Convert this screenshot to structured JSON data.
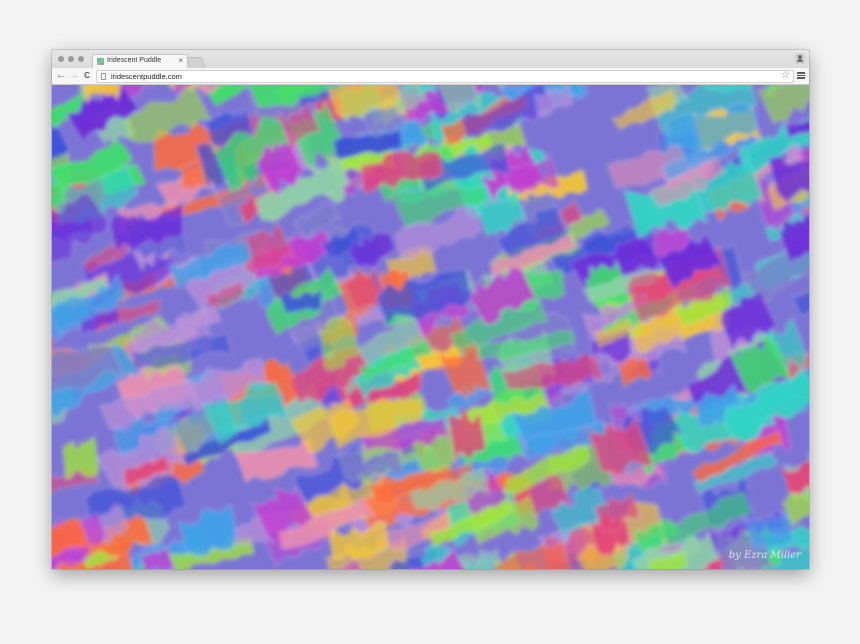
{
  "browser": {
    "tab": {
      "title": "Iridescent Puddle",
      "close_glyph": "×"
    },
    "toolbar": {
      "back_glyph": "←",
      "forward_glyph": "→",
      "reload_glyph": "C"
    },
    "address_bar": {
      "url": "iridescentpuddle.com",
      "bookmark_glyph": "☆"
    }
  },
  "page": {
    "signature": "by Ezra Miller",
    "palette": [
      "#3a4fd8",
      "#6c2bd9",
      "#c13fd1",
      "#e2457a",
      "#ff6a3a",
      "#f6c832",
      "#9fe63a",
      "#3ee06a",
      "#2fd6c4",
      "#3fa2e8",
      "#7d7ec9",
      "#b98fd8",
      "#e88fb0",
      "#8fd1a8"
    ]
  },
  "icons": {
    "traffic_lights": "window-controls-icon",
    "favicon": "favicon-icon",
    "page": "page-icon",
    "star": "star-icon",
    "menu": "hamburger-menu-icon",
    "profile": "profile-icon"
  }
}
